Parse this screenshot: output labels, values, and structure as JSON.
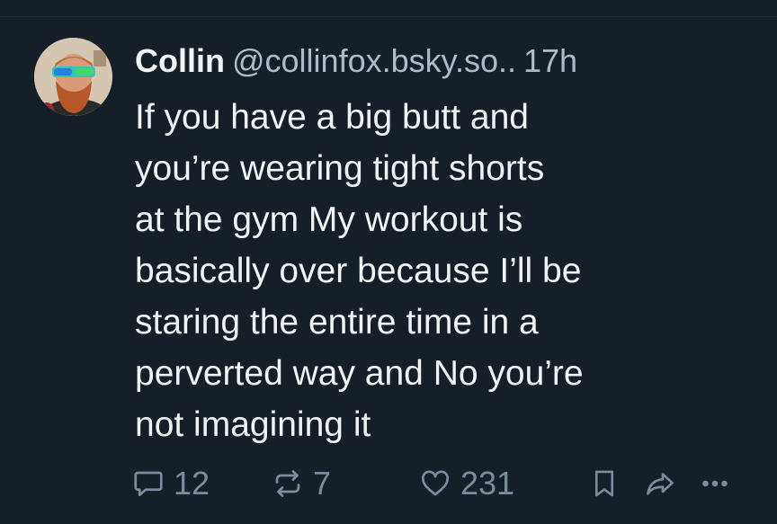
{
  "post": {
    "author_name": "Collin",
    "author_handle": "@collinfox.bsky.so..",
    "time": "17h",
    "text": "If you have a big butt and\nyou’re wearing tight shorts\nat the gym My workout is\nbasically over because I’ll be\nstaring the entire time in a\nperverted way and No you’re\nnot imagining it"
  },
  "actions": {
    "reply_count": "12",
    "repost_count": "7",
    "like_count": "231"
  },
  "icons": {
    "reply": "reply-icon",
    "repost": "repost-icon",
    "like": "heart-icon",
    "bookmark": "bookmark-icon",
    "share": "share-icon",
    "more": "more-icon"
  },
  "colors": {
    "background": "#161e27",
    "text": "#f1f3f5",
    "secondary_text": "#aebbc9",
    "icon": "#7c8b9d"
  }
}
